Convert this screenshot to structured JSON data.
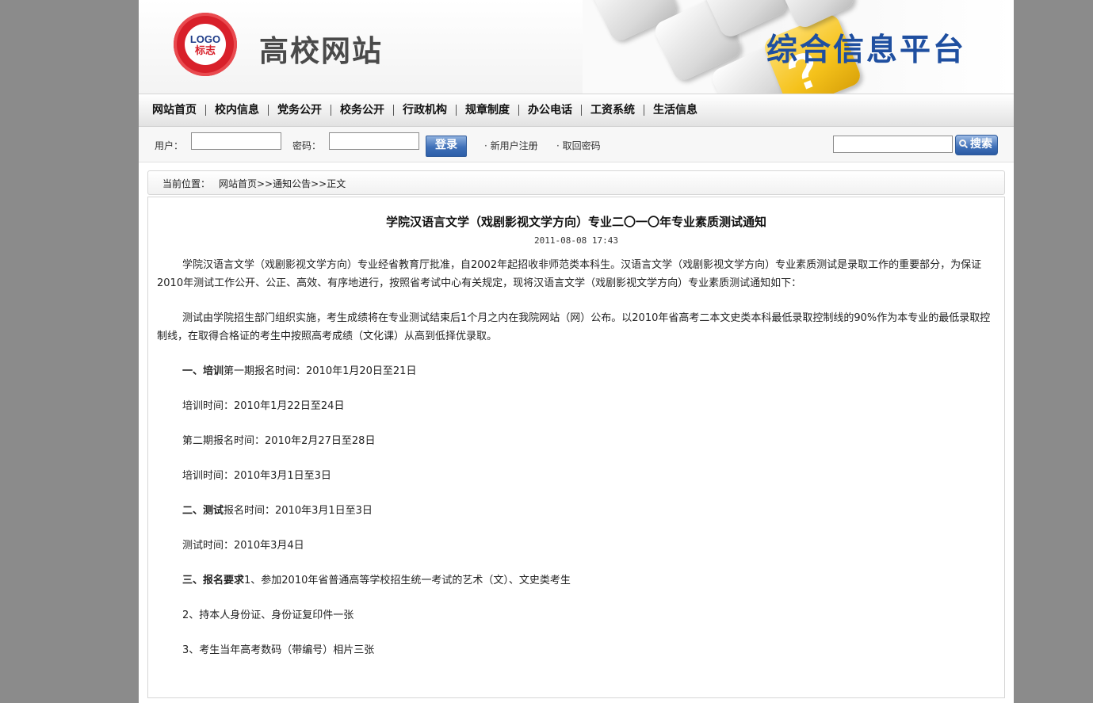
{
  "header": {
    "logo_text": "LOGO",
    "logo_sub": "标志",
    "logo_ring": "高校网站模板 Visual SiteBuilder",
    "site_title": "高校网站",
    "platform_title": "综合信息平台"
  },
  "nav": {
    "items": [
      "网站首页",
      "校内信息",
      "党务公开",
      "校务公开",
      "行政机构",
      "规章制度",
      "办公电话",
      "工资系统",
      "生活信息"
    ]
  },
  "login": {
    "user_label": "用户：",
    "user_value": "",
    "password_label": "密码：",
    "password_value": "",
    "login_button": "登录",
    "register_link": "· 新用户注册",
    "retrieve_link": "· 取回密码",
    "search_value": "",
    "search_button": "搜索"
  },
  "breadcrumb": {
    "label": "当前位置：",
    "path": "网站首页>>通知公告>>正文"
  },
  "article": {
    "title": "学院汉语言文学（戏剧影视文学方向）专业二〇一〇年专业素质测试通知",
    "date": "2011-08-08 17:43",
    "para1": "学院汉语言文学（戏剧影视文学方向）专业经省教育厅批准，自2002年起招收非师范类本科生。汉语言文学（戏剧影视文学方向）专业素质测试是录取工作的重要部分，为保证2010年测试工作公开、公正、高效、有序地进行，按照省考试中心有关规定，现将汉语言文学（戏剧影视文学方向）专业素质测试通知如下：",
    "para2": "测试由学院招生部门组织实施，考生成绩将在专业测试结束后1个月之内在我院网站（网）公布。以2010年省高考二本文史类本科最低录取控制线的90%作为本专业的最低录取控制线，在取得合格证的考生中按照高考成绩（文化课）从高到低择优录取。",
    "s1_head": "一、培训",
    "s1_text": "第一期报名时间：2010年1月20日至21日",
    "s1_line2": "培训时间：2010年1月22日至24日",
    "s1_line3": "第二期报名时间：2010年2月27日至28日",
    "s1_line4": "培训时间：2010年3月1日至3日",
    "s2_head": "二、测试",
    "s2_text": "报名时间：2010年3月1日至3日",
    "s2_line2": "测试时间：2010年3月4日",
    "s3_head": "三、报名要求",
    "s3_text": "1、参加2010年省普通高等学校招生统一考试的艺术（文）、文史类考生",
    "s3_line2": "2、持本人身份证、身份证复印件一张",
    "s3_line3": "3、考生当年高考数码（带编号）相片三张"
  },
  "colors": {
    "page_bg": "#8b8b8b",
    "platform_title": "#1f4fa0",
    "logo_red": "#d8202a",
    "button_blue": "#3f70b8"
  }
}
